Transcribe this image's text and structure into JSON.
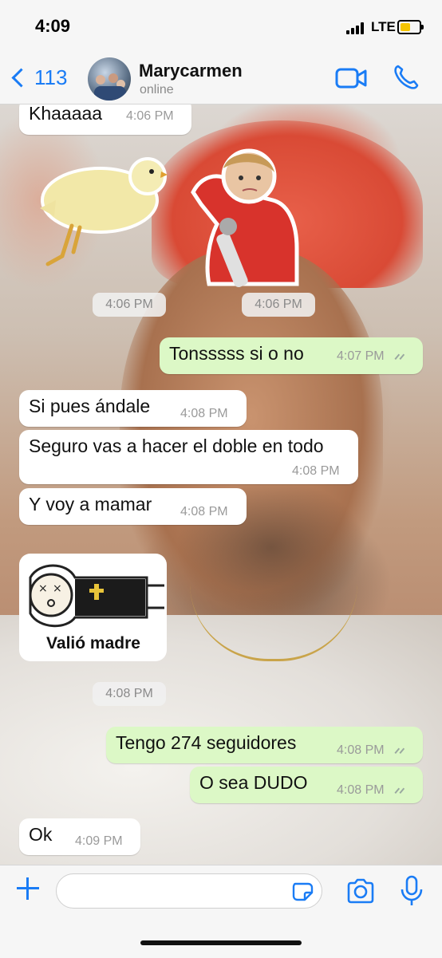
{
  "status_bar": {
    "time": "4:09",
    "network": "LTE"
  },
  "header": {
    "back_count": "113",
    "contact_name": "Marycarmen",
    "contact_status": "online",
    "icons": [
      "chevron-left-icon",
      "video-call-icon",
      "phone-call-icon"
    ]
  },
  "messages": [
    {
      "dir": "in",
      "text": "Khaaaaa",
      "time": "4:06 PM"
    },
    {
      "type": "sticker-time",
      "time": "4:06 PM"
    },
    {
      "type": "sticker-time",
      "time": "4:06 PM"
    },
    {
      "dir": "out",
      "text": "Tonsssss si o no",
      "time": "4:07 PM",
      "read": true
    },
    {
      "dir": "in",
      "text": "Si pues ándale",
      "time": "4:08 PM"
    },
    {
      "dir": "in",
      "text": "Seguro vas a hacer el doble en todo",
      "time": "4:08 PM"
    },
    {
      "dir": "in",
      "text": "Y voy a mamar",
      "time": "4:08 PM"
    },
    {
      "type": "sticker",
      "caption": "Valió madre",
      "time": "4:08 PM"
    },
    {
      "dir": "out",
      "text": "Tengo 274 seguidores",
      "time": "4:08 PM",
      "read": true
    },
    {
      "dir": "out",
      "text": "O sea DUDO",
      "time": "4:08 PM",
      "read": true
    },
    {
      "dir": "in",
      "text": "Ok",
      "time": "4:09 PM"
    }
  ],
  "input_bar": {
    "placeholder": "",
    "icons": [
      "plus-icon",
      "sticker-icon",
      "camera-icon",
      "microphone-icon"
    ]
  },
  "colors": {
    "accent": "#1a7cf5",
    "outgoing_bubble": "#dcf8c6",
    "incoming_bubble": "#ffffff"
  }
}
